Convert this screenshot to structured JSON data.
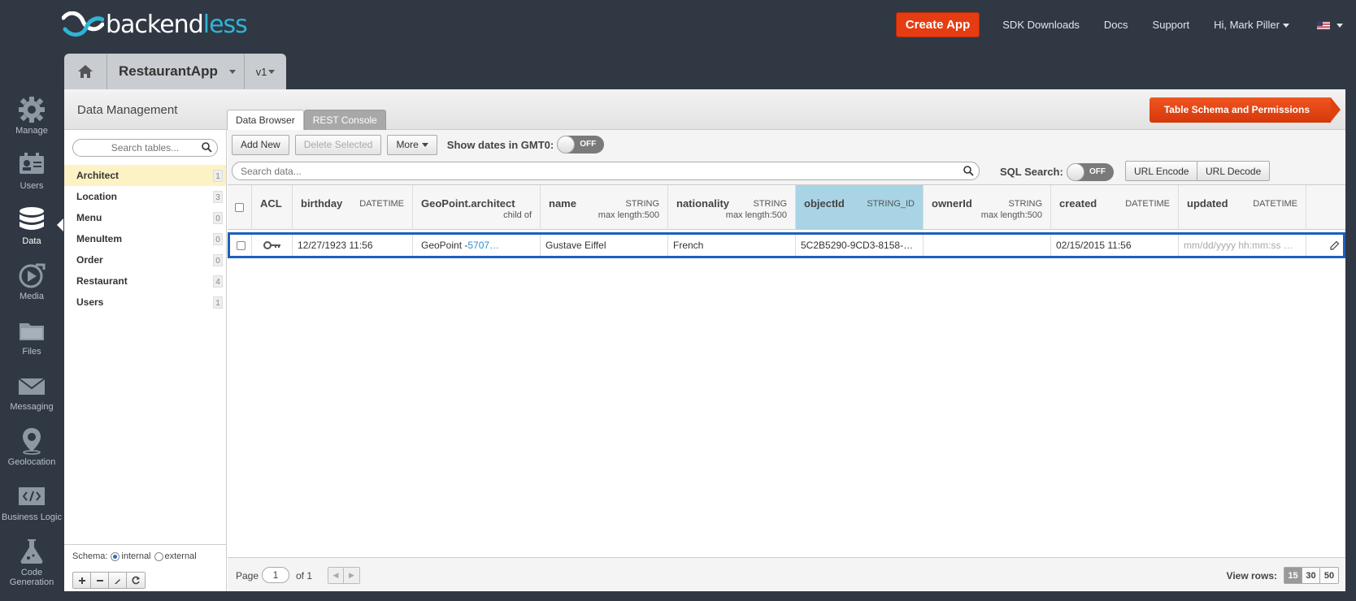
{
  "brand": {
    "name_main": "backend",
    "name_accent": "less"
  },
  "topnav": {
    "create_app": "Create App",
    "sdk": "SDK Downloads",
    "docs": "Docs",
    "support": "Support",
    "user": "Hi, Mark Piller"
  },
  "leftnav": [
    {
      "label": "Manage"
    },
    {
      "label": "Users"
    },
    {
      "label": "Data"
    },
    {
      "label": "Media"
    },
    {
      "label": "Files"
    },
    {
      "label": "Messaging"
    },
    {
      "label": "Geolocation"
    },
    {
      "label": "Business Logic"
    },
    {
      "label": "Code",
      "label2": "Generation"
    }
  ],
  "app": {
    "name": "RestaurantApp",
    "version": "v1"
  },
  "panel": {
    "title": "Data Management",
    "tab_browser": "Data Browser",
    "tab_rest": "REST Console",
    "schema_button": "Table Schema and Permissions"
  },
  "tables": {
    "search_placeholder": "Search tables...",
    "items": [
      {
        "name": "Architect",
        "count": "1"
      },
      {
        "name": "Location",
        "count": "3"
      },
      {
        "name": "Menu",
        "count": "0"
      },
      {
        "name": "MenuItem",
        "count": "0"
      },
      {
        "name": "Order",
        "count": "0"
      },
      {
        "name": "Restaurant",
        "count": "4"
      },
      {
        "name": "Users",
        "count": "1"
      }
    ],
    "schema_label": "Schema:",
    "schema_internal": "internal",
    "schema_external": "external"
  },
  "toolbar": {
    "add_new": "Add New",
    "delete_selected": "Delete Selected",
    "more": "More",
    "gmt_label": "Show dates in GMT0:",
    "gmt_toggle": "OFF",
    "search_placeholder": "Search data...",
    "sql_label": "SQL Search:",
    "sql_toggle": "OFF",
    "url_encode": "URL Encode",
    "url_decode": "URL Decode"
  },
  "columns": [
    {
      "name": "ACL"
    },
    {
      "name": "birthday",
      "type": "DATETIME"
    },
    {
      "name": "GeoPoint.architect",
      "sub": "child of"
    },
    {
      "name": "name",
      "type": "STRING",
      "sub": "max length:500"
    },
    {
      "name": "nationality",
      "type": "STRING",
      "sub": "max length:500"
    },
    {
      "name": "objectId",
      "type": "STRING_ID"
    },
    {
      "name": "ownerId",
      "type": "STRING",
      "sub": "max length:500"
    },
    {
      "name": "created",
      "type": "DATETIME"
    },
    {
      "name": "updated",
      "type": "DATETIME"
    }
  ],
  "row": {
    "birthday": "12/27/1923 11:56",
    "geopoint_prefix": "GeoPoint - ",
    "geopoint_link": "5707…",
    "name": "Gustave Eiffel",
    "nationality": "French",
    "objectId": "5C2B5290-9CD3-8158-…",
    "ownerId": "",
    "created": "02/15/2015 11:56",
    "updated_placeholder": "mm/dd/yyyy hh:mm:ss …"
  },
  "footer": {
    "page_label": "Page",
    "page": "1",
    "of": "of 1",
    "view_rows": "View rows:",
    "sizes": [
      "15",
      "30",
      "50"
    ]
  },
  "colors": {
    "accent": "#e63c12",
    "highlight": "#a9d4e6",
    "selection": "#1d5fbd",
    "brand_accent": "#2fb4d6"
  }
}
